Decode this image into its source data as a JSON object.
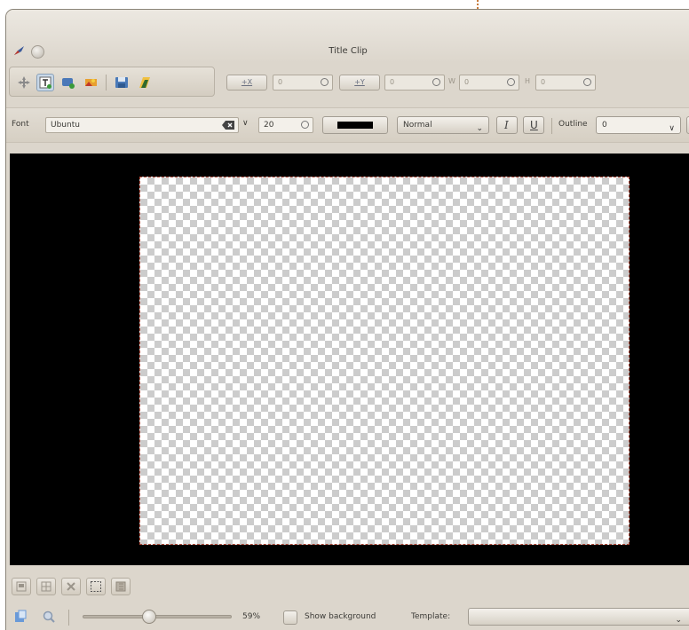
{
  "window": {
    "title": "Title Clip"
  },
  "toolbar": {
    "tools": [
      "select-tool-icon",
      "text-tool-icon",
      "rectangle-tool-icon",
      "image-tool-icon",
      "save-icon",
      "open-document-icon"
    ],
    "x_button": "+X",
    "x_value": "0",
    "y_button": "+Y",
    "y_value": "0",
    "w_label": "W",
    "w_value": "0",
    "h_label": "H",
    "h_value": "0"
  },
  "text_options": {
    "font_label": "Font",
    "font_value": "Ubuntu",
    "size_value": "20",
    "color": "#000000",
    "weight_value": "Normal",
    "outline_label": "Outline",
    "outline_value": "0"
  },
  "bottom": {
    "zoom_value": 0.59,
    "zoom_text": "59%",
    "show_background_label": "Show background",
    "template_label": "Template:",
    "template_value": ""
  }
}
